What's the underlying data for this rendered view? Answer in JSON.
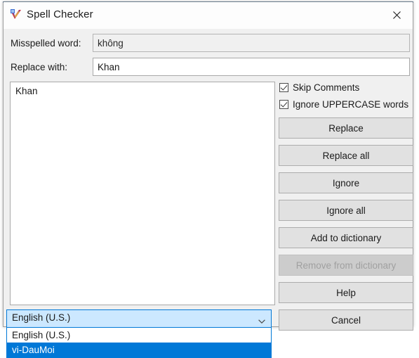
{
  "window": {
    "title": "Spell Checker",
    "icon": "spellcheck-icon",
    "close_label": "✕"
  },
  "form": {
    "misspelled_label": "Misspelled word:",
    "misspelled_value": "không",
    "replace_label": "Replace with:",
    "replace_value": "Khan"
  },
  "suggestions": {
    "items": [
      {
        "label": "Khan"
      }
    ]
  },
  "options": [
    {
      "label": "Skip Comments",
      "checked": true
    },
    {
      "label": "Ignore UPPERCASE words",
      "checked": true
    }
  ],
  "buttons": [
    {
      "label": "Replace",
      "disabled": false
    },
    {
      "label": "Replace all",
      "disabled": false
    },
    {
      "label": "Ignore",
      "disabled": false
    },
    {
      "label": "Ignore all",
      "disabled": false
    },
    {
      "label": "Add to dictionary",
      "disabled": false
    },
    {
      "label": "Remove from dictionary",
      "disabled": true
    },
    {
      "label": "Help",
      "disabled": false
    },
    {
      "label": "Cancel",
      "disabled": false
    }
  ],
  "language": {
    "selected": "English (U.S.)",
    "expanded": true,
    "options": [
      {
        "label": "English (U.S.)",
        "highlighted": false
      },
      {
        "label": "vi-DauMoi",
        "highlighted": true
      }
    ]
  },
  "colors": {
    "accent": "#0078d7",
    "combo_open_bg": "#cce8ff",
    "dialog_bg": "#f0f0f0",
    "button_bg": "#e1e1e1",
    "disabled_text": "#a0a0a0"
  }
}
